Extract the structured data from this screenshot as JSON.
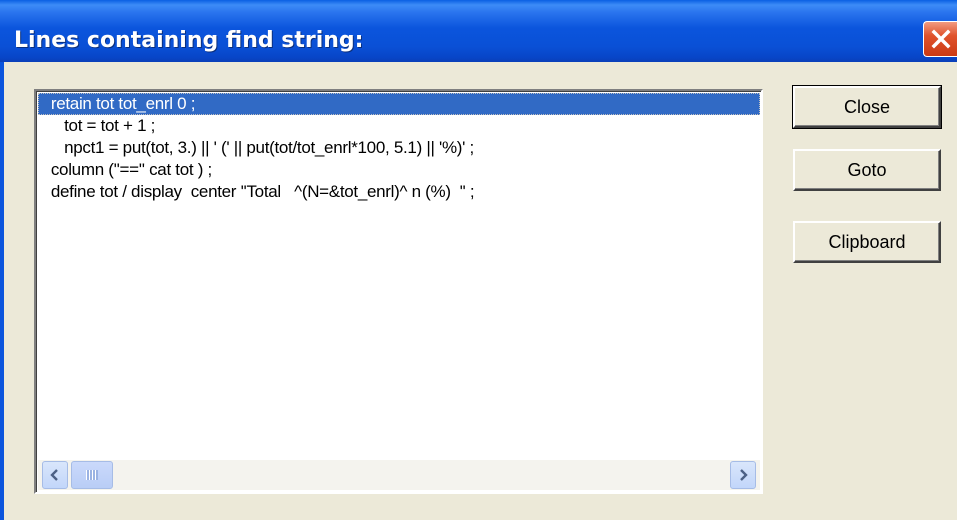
{
  "window": {
    "title": "Lines containing find string:",
    "close_icon": "close-x-icon"
  },
  "list": {
    "selected_index": 0,
    "lines": [
      "  retain tot tot_enrl 0 ;",
      "     tot = tot + 1 ;",
      "     npct1 = put(tot, 3.) || ' (' || put(tot/tot_enrl*100, 5.1) || '%)' ;",
      "  column (''=='' cat tot ) ;",
      "  define tot / display  center ''Total   ^(N=&tot_enrl)^ n (%)  '' ;"
    ]
  },
  "buttons": {
    "close": "Close",
    "goto": "Goto",
    "clipboard": "Clipboard"
  },
  "colors": {
    "title_bar": "#0a50d6",
    "selection": "#316ac5",
    "close_button": "#e0532c",
    "dialog_face": "#ece9d8"
  }
}
